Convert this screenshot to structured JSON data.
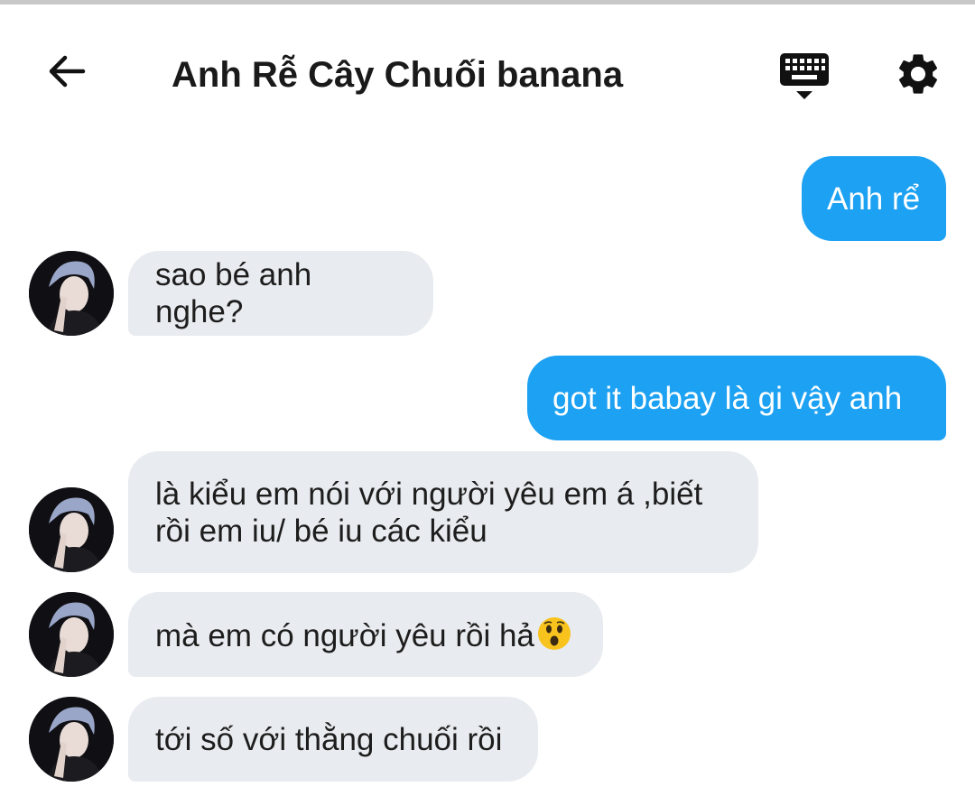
{
  "header": {
    "back_icon": "arrow-left-icon",
    "title": "Anh Rễ Cây Chuối banana",
    "keyboard_icon": "keyboard-icon",
    "settings_icon": "gear-icon"
  },
  "colors": {
    "outgoing_bubble": "#1da1f2",
    "incoming_bubble": "#e8ebef",
    "text": "#1d1d1d"
  },
  "messages": [
    {
      "direction": "outgoing",
      "text": "Anh rể"
    },
    {
      "direction": "incoming",
      "text": "sao bé anh nghe?"
    },
    {
      "direction": "outgoing",
      "text": "got it babay là gi vậy anh"
    },
    {
      "direction": "incoming",
      "lines": [
        "là kiểu em nói với người yêu em á ,biết",
        "rồi em iu/ bé iu các kiểu"
      ]
    },
    {
      "direction": "incoming",
      "text": "mà em có người yêu rồi hả",
      "emoji": "astonished-face-emoji"
    },
    {
      "direction": "incoming",
      "text": "tới số với thằng chuối rồi"
    }
  ]
}
